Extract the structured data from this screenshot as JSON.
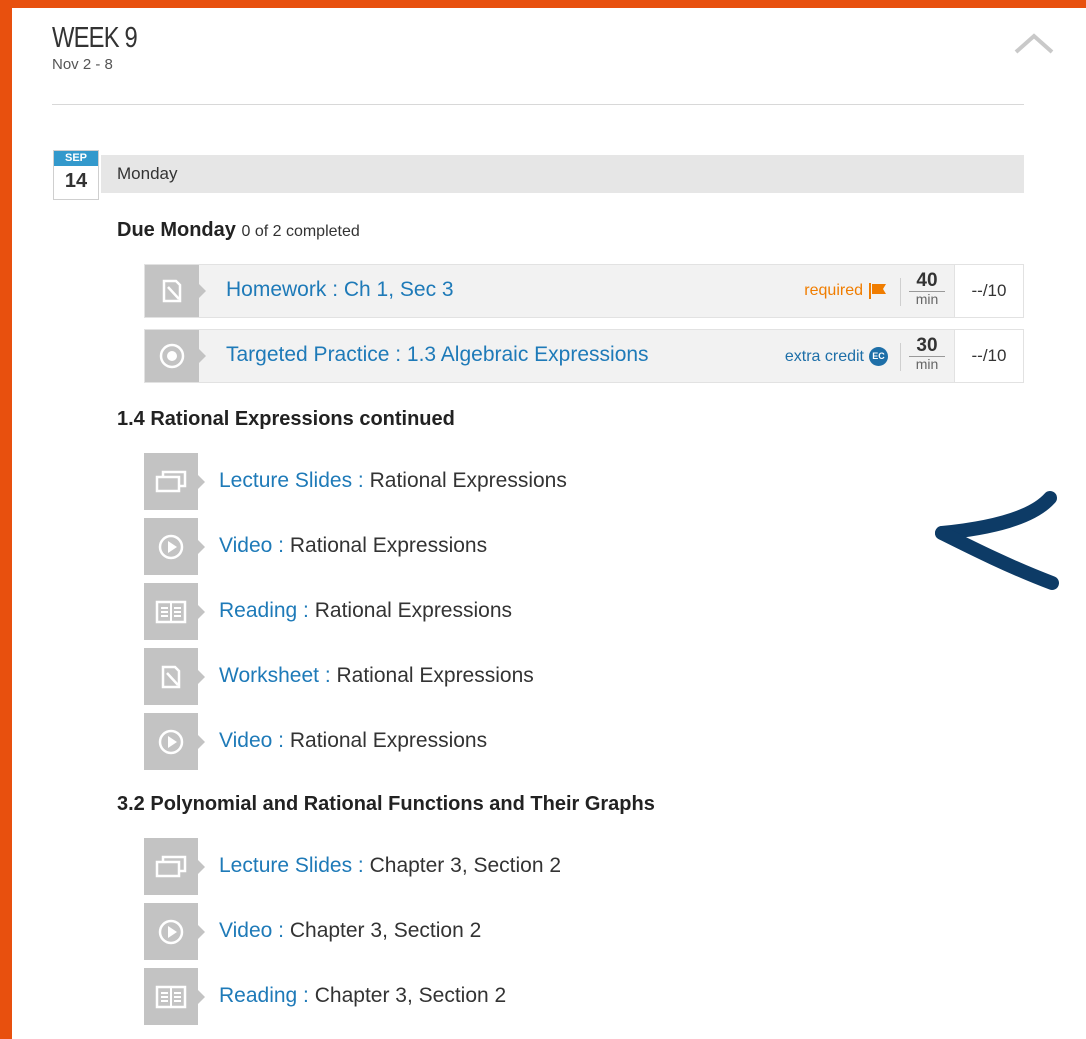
{
  "week": {
    "title": "WEEK 9",
    "range": "Nov 2 - 8"
  },
  "date": {
    "month": "SEP",
    "day": "14",
    "weekday": "Monday"
  },
  "due": {
    "heading": "Due Monday",
    "status": "0 of 2 completed",
    "items": [
      {
        "kind": "Homework",
        "title": "Homework : Ch 1, Sec 3",
        "tag": "required",
        "minutes": "40",
        "unit": "min",
        "score": "--/10",
        "icon": "worksheet-icon"
      },
      {
        "kind": "Targeted Practice",
        "title": "Targeted Practice : 1.3 Algebraic Expressions",
        "tag": "extra credit",
        "badge": "EC",
        "minutes": "30",
        "unit": "min",
        "score": "--/10",
        "icon": "target-icon"
      }
    ]
  },
  "sections": [
    {
      "title": "1.4 Rational Expressions continued",
      "items": [
        {
          "kind": "Lecture Slides :",
          "name": "Rational Expressions",
          "icon": "slides-icon"
        },
        {
          "kind": "Video :",
          "name": "Rational Expressions",
          "icon": "video-icon"
        },
        {
          "kind": "Reading :",
          "name": "Rational Expressions",
          "icon": "reading-icon"
        },
        {
          "kind": "Worksheet :",
          "name": "Rational Expressions",
          "icon": "worksheet-icon"
        },
        {
          "kind": "Video :",
          "name": "Rational Expressions",
          "icon": "video-icon"
        }
      ]
    },
    {
      "title": "3.2 Polynomial and Rational Functions and Their Graphs",
      "items": [
        {
          "kind": "Lecture Slides :",
          "name": "Chapter 3, Section 2",
          "icon": "slides-icon"
        },
        {
          "kind": "Video :",
          "name": "Chapter 3, Section 2",
          "icon": "video-icon"
        },
        {
          "kind": "Reading :",
          "name": "Chapter 3, Section 2",
          "icon": "reading-icon"
        }
      ]
    }
  ],
  "colors": {
    "frame": "#e8500e",
    "link": "#1e7ab8",
    "required": "#f07d00",
    "extra_credit": "#1e6fa8",
    "arrow": "#0d3b66",
    "date_blue": "#3399cc"
  }
}
